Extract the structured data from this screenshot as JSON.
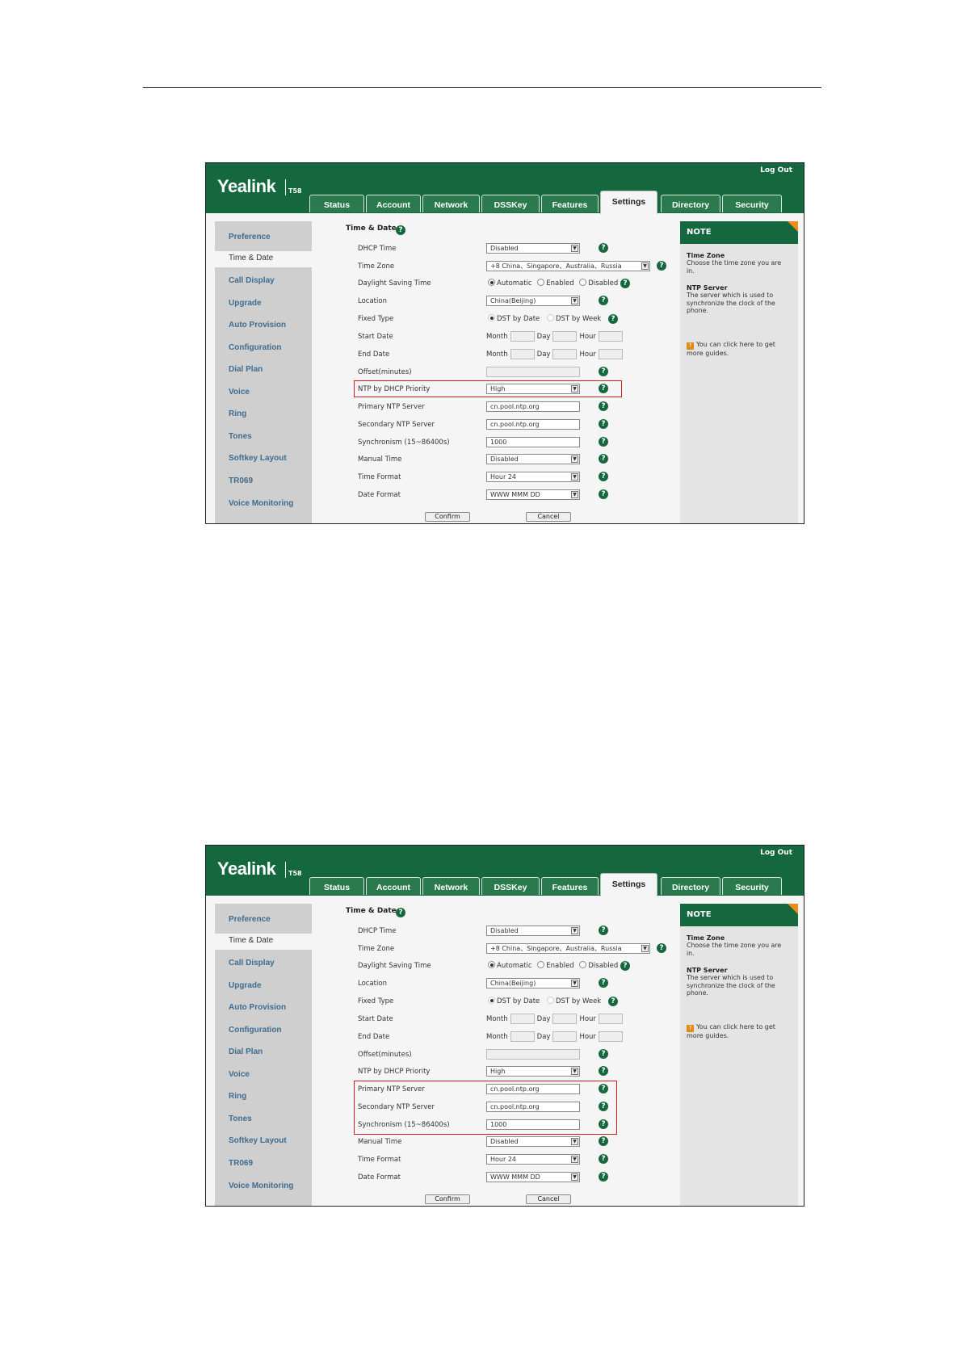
{
  "app": {
    "logout": "Log Out",
    "logo": "Yealink",
    "model": "T58"
  },
  "tabs": [
    "Status",
    "Account",
    "Network",
    "DSSKey",
    "Features",
    "Settings",
    "Directory",
    "Security"
  ],
  "active_tab": "Settings",
  "sidebar": [
    "Preference",
    "Time & Date",
    "Call Display",
    "Upgrade",
    "Auto Provision",
    "Configuration",
    "Dial Plan",
    "Voice",
    "Ring",
    "Tones",
    "Softkey Layout",
    "TR069",
    "Voice Monitoring"
  ],
  "active_sidebar": "Time & Date",
  "section_title": "Time & Date",
  "fields": {
    "dhcp_time": {
      "label": "DHCP Time",
      "value": "Disabled"
    },
    "time_zone": {
      "label": "Time Zone",
      "value": "+8 China、Singapore、Australia、Russia"
    },
    "dst": {
      "label": "Daylight Saving Time",
      "options": [
        "Automatic",
        "Enabled",
        "Disabled"
      ],
      "selected": "Automatic"
    },
    "location": {
      "label": "Location",
      "value": "China(Beijing)"
    },
    "fixed_type": {
      "label": "Fixed Type",
      "options": [
        "DST by Date",
        "DST by Week"
      ],
      "selected": "DST by Date"
    },
    "start_date": {
      "label": "Start Date"
    },
    "end_date": {
      "label": "End Date"
    },
    "date_parts": [
      "Month",
      "Day",
      "Hour"
    ],
    "offset": {
      "label": "Offset(minutes)",
      "value": ""
    },
    "ntp_dhcp_priority": {
      "label": "NTP by DHCP Priority",
      "value": "High"
    },
    "primary_ntp": {
      "label": "Primary NTP Server",
      "value": "cn.pool.ntp.org"
    },
    "secondary_ntp": {
      "label": "Secondary NTP Server",
      "value": "cn.pool.ntp.org"
    },
    "sync": {
      "label": "Synchronism (15~86400s)",
      "value": "1000"
    },
    "manual_time": {
      "label": "Manual Time",
      "value": "Disabled"
    },
    "time_format": {
      "label": "Time Format",
      "value": "Hour 24"
    },
    "date_format": {
      "label": "Date Format",
      "value": "WWW MMM DD"
    }
  },
  "buttons": {
    "confirm": "Confirm",
    "cancel": "Cancel"
  },
  "note": {
    "title": "NOTE",
    "tz_title": "Time Zone",
    "tz_text": "Choose the time zone you are in.",
    "ntp_title": "NTP Server",
    "ntp_text": "The server which is used to synchronize the clock of the phone.",
    "tip": "You can click here to get more guides."
  },
  "colors": {
    "brand": "#15683d",
    "highlight": "#d6191d",
    "note_corner": "#f08a1c"
  }
}
